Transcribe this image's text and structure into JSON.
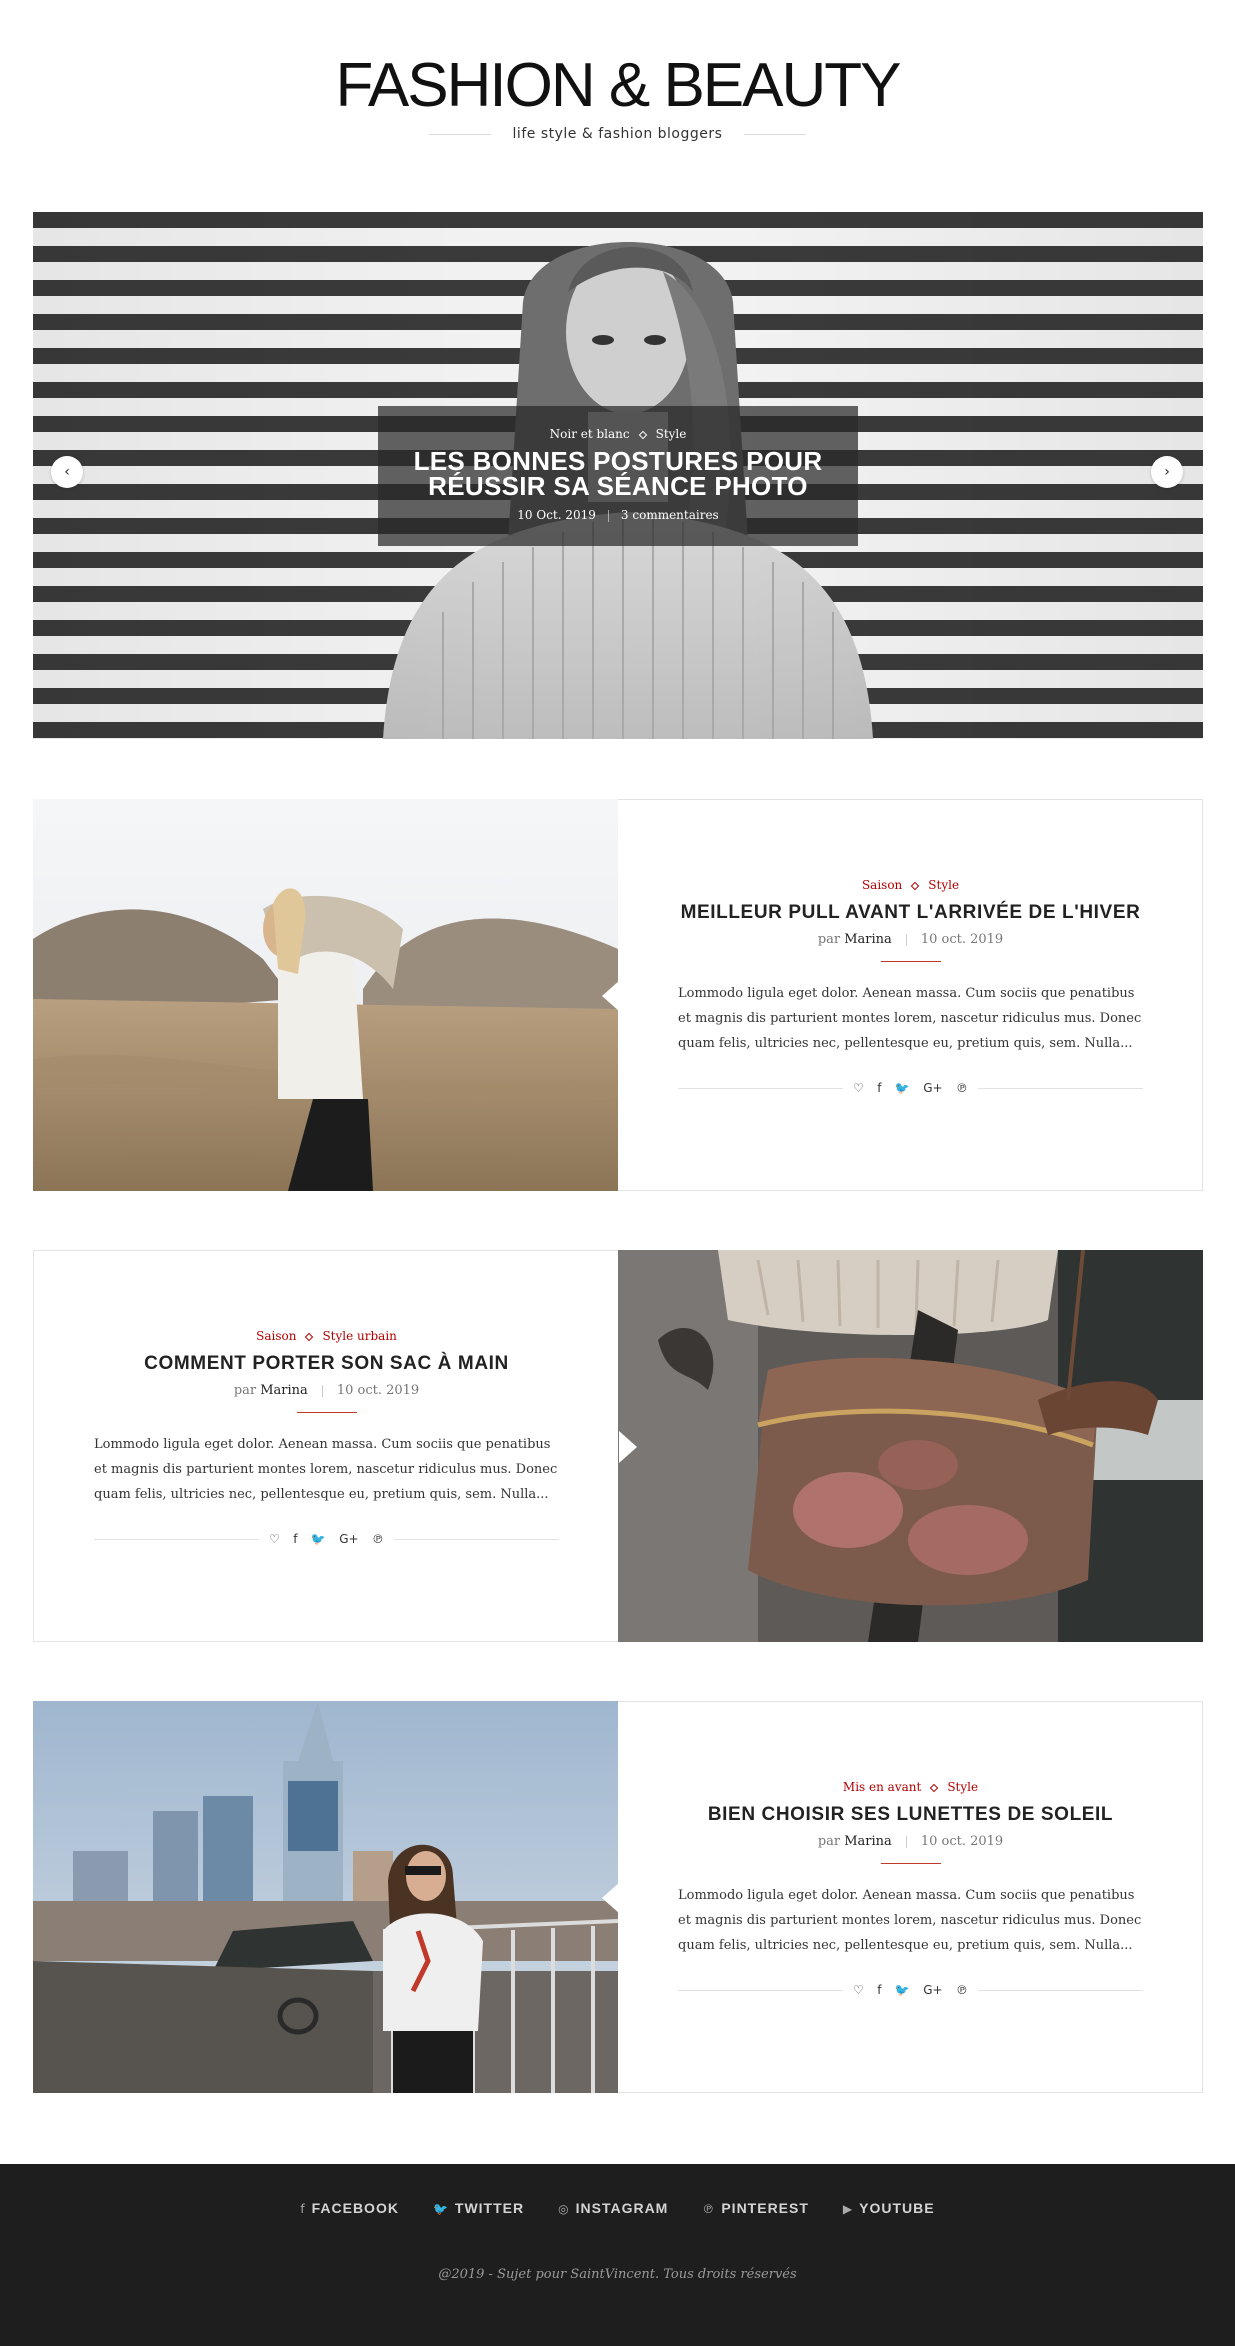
{
  "header": {
    "title": "FASHION & BEAUTY",
    "tagline": "life style & fashion bloggers"
  },
  "slider": {
    "categories": [
      "Noir et blanc",
      "Style"
    ],
    "title_line1": "LES BONNES POSTURES POUR",
    "title_line2": "RÉUSSIR SA SÉANCE PHOTO",
    "date": "10 Oct. 2019",
    "comments": "3 commentaires",
    "prev_icon": "‹",
    "next_icon": "›"
  },
  "posts": [
    {
      "categories": [
        "Saison",
        "Style"
      ],
      "title": "MEILLEUR PULL AVANT L'ARRIVÉE DE L'HIVER",
      "by": "par",
      "author": "Marina",
      "date": "10 oct. 2019",
      "excerpt": "Lommodo ligula eget dolor. Aenean massa. Cum sociis que penatibus et magnis dis parturient montes lorem, nascetur ridiculus mus. Donec quam felis, ultricies nec, pellentesque eu, pretium quis, sem. Nulla..."
    },
    {
      "categories": [
        "Saison",
        "Style urbain"
      ],
      "title": "COMMENT PORTER SON SAC À MAIN",
      "by": "par",
      "author": "Marina",
      "date": "10 oct. 2019",
      "excerpt": "Lommodo ligula eget dolor. Aenean massa. Cum sociis que penatibus et magnis dis parturient montes lorem, nascetur ridiculus mus. Donec quam felis, ultricies nec, pellentesque eu, pretium quis, sem. Nulla..."
    },
    {
      "categories": [
        "Mis en avant",
        "Style"
      ],
      "title": "BIEN CHOISIR SES LUNETTES DE SOLEIL",
      "by": "par",
      "author": "Marina",
      "date": "10 oct. 2019",
      "excerpt": "Lommodo ligula eget dolor. Aenean massa. Cum sociis que penatibus et magnis dis parturient montes lorem, nascetur ridiculus mus. Donec quam felis, ultricies nec, pellentesque eu, pretium quis, sem. Nulla..."
    }
  ],
  "share_icons": [
    "heart-icon",
    "facebook-icon",
    "twitter-icon",
    "google-plus-icon",
    "pinterest-icon"
  ],
  "share_glyphs": {
    "heart": "♡",
    "facebook": "f",
    "twitter": "🐦",
    "google_plus": "G+",
    "pinterest": "℗"
  },
  "footer": {
    "links": [
      {
        "icon": "facebook-icon",
        "glyph": "f",
        "label": "FACEBOOK"
      },
      {
        "icon": "twitter-icon",
        "glyph": "🐦",
        "label": "TWITTER"
      },
      {
        "icon": "instagram-icon",
        "glyph": "◎",
        "label": "INSTAGRAM"
      },
      {
        "icon": "pinterest-icon",
        "glyph": "℗",
        "label": "PINTEREST"
      },
      {
        "icon": "youtube-icon",
        "glyph": "▶",
        "label": "YOUTUBE"
      }
    ],
    "copyright": "@2019 - Sujet pour SaintVincent. Tous droits réservés"
  },
  "colors": {
    "accent": "#b00000",
    "footer_bg": "#1e1e1e",
    "border": "#e3e3e3"
  }
}
